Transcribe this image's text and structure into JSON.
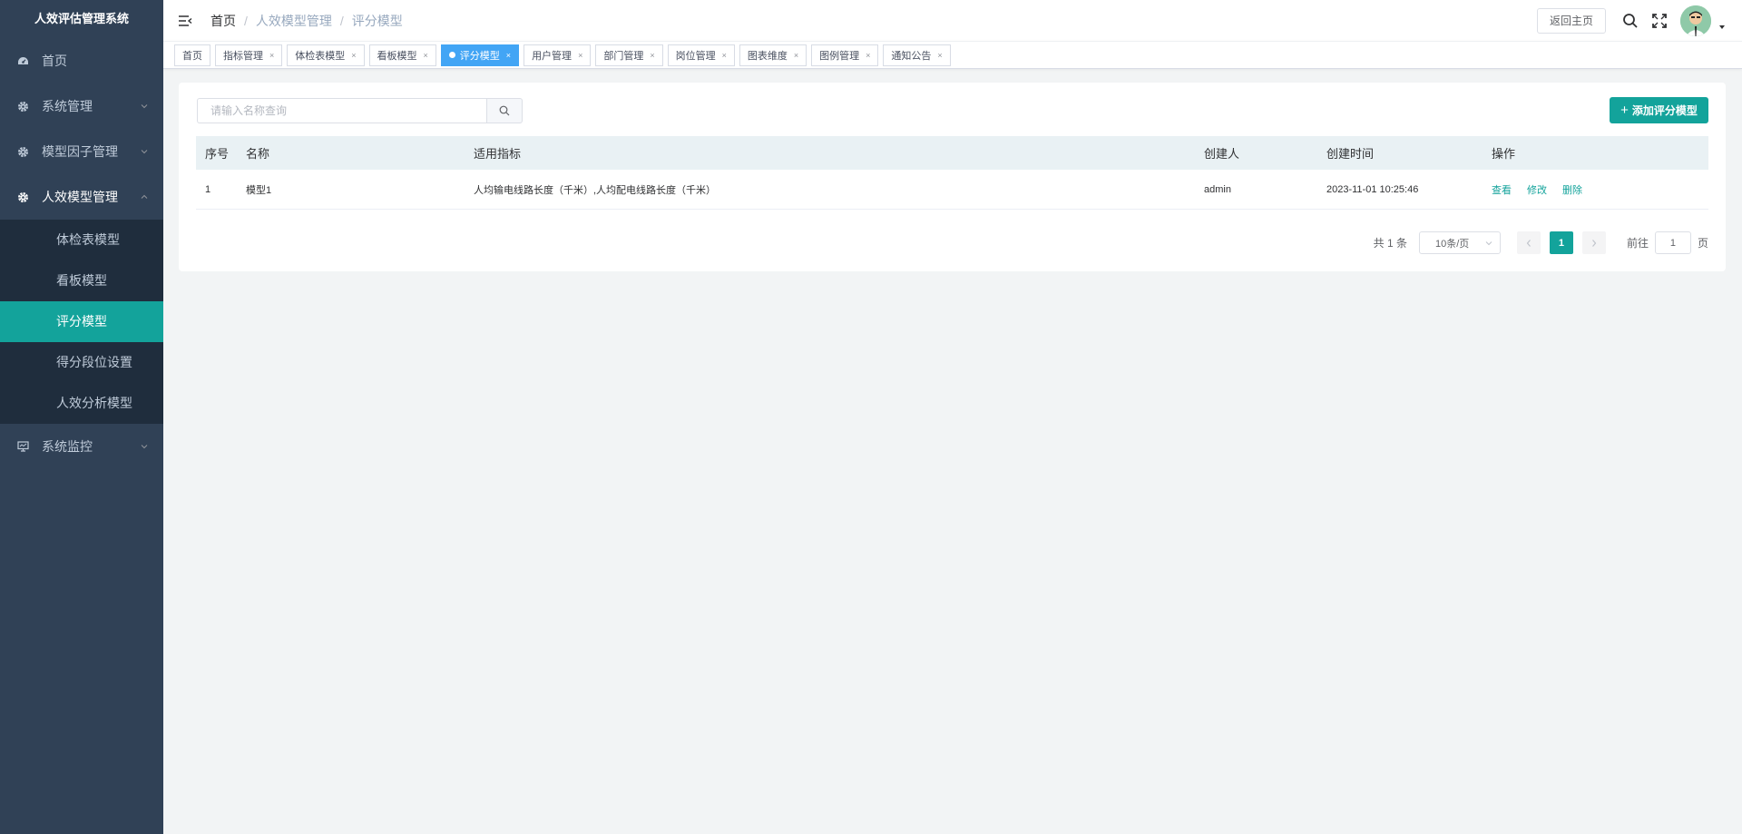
{
  "app": {
    "title": "人效评估管理系统"
  },
  "sidebar": {
    "items": [
      {
        "label": "首页",
        "icon": "dashboard-icon"
      },
      {
        "label": "系统管理",
        "icon": "gear-icon"
      },
      {
        "label": "模型因子管理",
        "icon": "gear-icon"
      },
      {
        "label": "人效模型管理",
        "icon": "gear-icon"
      }
    ],
    "submenu": [
      {
        "label": "体检表模型"
      },
      {
        "label": "看板模型"
      },
      {
        "label": "评分模型"
      },
      {
        "label": "得分段位设置"
      },
      {
        "label": "人效分析模型"
      }
    ],
    "monitor": {
      "label": "系统监控",
      "icon": "monitor-icon"
    }
  },
  "header": {
    "breadcrumb": [
      "首页",
      "人效模型管理",
      "评分模型"
    ],
    "breadcrumb_separator": "/",
    "home_button": "返回主页"
  },
  "tags": [
    {
      "label": "首页",
      "closable": false
    },
    {
      "label": "指标管理",
      "closable": true
    },
    {
      "label": "体检表模型",
      "closable": true
    },
    {
      "label": "看板模型",
      "closable": true
    },
    {
      "label": "评分模型",
      "closable": true,
      "active": true
    },
    {
      "label": "用户管理",
      "closable": true
    },
    {
      "label": "部门管理",
      "closable": true
    },
    {
      "label": "岗位管理",
      "closable": true
    },
    {
      "label": "图表维度",
      "closable": true
    },
    {
      "label": "图例管理",
      "closable": true
    },
    {
      "label": "通知公告",
      "closable": true
    }
  ],
  "tag_close": "×",
  "main": {
    "search": {
      "placeholder": "请输入名称查询",
      "value": ""
    },
    "add_button": {
      "icon": "plus-icon",
      "label": "添加评分模型",
      "plus": "+"
    },
    "table": {
      "headers": [
        "序号",
        "名称",
        "适用指标",
        "创建人",
        "创建时间",
        "操作"
      ],
      "rows": [
        {
          "index": "1",
          "name": "模型1",
          "indicators": "人均输电线路长度（千米）,人均配电线路长度（千米）",
          "creator": "admin",
          "created_at": "2023-11-01 10:25:46",
          "actions": [
            "查看",
            "修改",
            "删除"
          ]
        }
      ]
    },
    "pagination": {
      "total": "共 1 条",
      "page_size": "10条/页",
      "current_page": "1",
      "goto_prefix": "前往",
      "goto_value": "1",
      "goto_suffix": "页"
    }
  },
  "colors": {
    "sidebar_bg": "#304156",
    "submenu_bg": "#1f2d3d",
    "accent": "#13a39b",
    "active_tag": "#42a5f5"
  }
}
